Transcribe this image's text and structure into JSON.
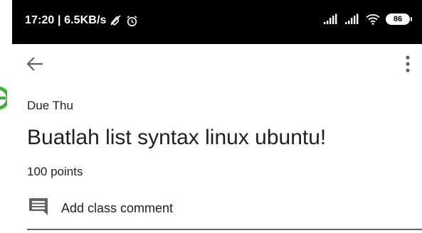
{
  "status_bar": {
    "time_speed": "17:20 | 6.5KB/s",
    "icons": [
      "data-saver-icon",
      "alarm-icon",
      "signal-icon",
      "signal-icon",
      "wifi-icon",
      "battery-icon"
    ],
    "battery_level": "86"
  },
  "app_bar": {
    "back_icon": "arrow-back-icon",
    "menu_icon": "more-vert-icon"
  },
  "assignment": {
    "due": "Due Thu",
    "title": "Buatlah list syntax linux ubuntu!",
    "points": "100 points"
  },
  "comments": {
    "icon": "comment-icon",
    "add_label": "Add class comment"
  },
  "colors": {
    "status_bar_bg": "#000000",
    "text": "#202124",
    "icon": "#5f6368",
    "edge_green": "#3fae3a"
  }
}
